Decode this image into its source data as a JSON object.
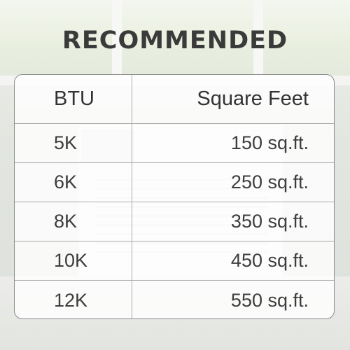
{
  "title": "RECOMMENDED",
  "table": {
    "headers": [
      "BTU",
      "Square Feet"
    ],
    "rows": [
      {
        "btu": "5K",
        "area": "150 sq.ft."
      },
      {
        "btu": "6K",
        "area": "250 sq.ft."
      },
      {
        "btu": "8K",
        "area": "350 sq.ft."
      },
      {
        "btu": "10K",
        "area": "450 sq.ft."
      },
      {
        "btu": "12K",
        "area": "550 sq.ft."
      }
    ]
  }
}
